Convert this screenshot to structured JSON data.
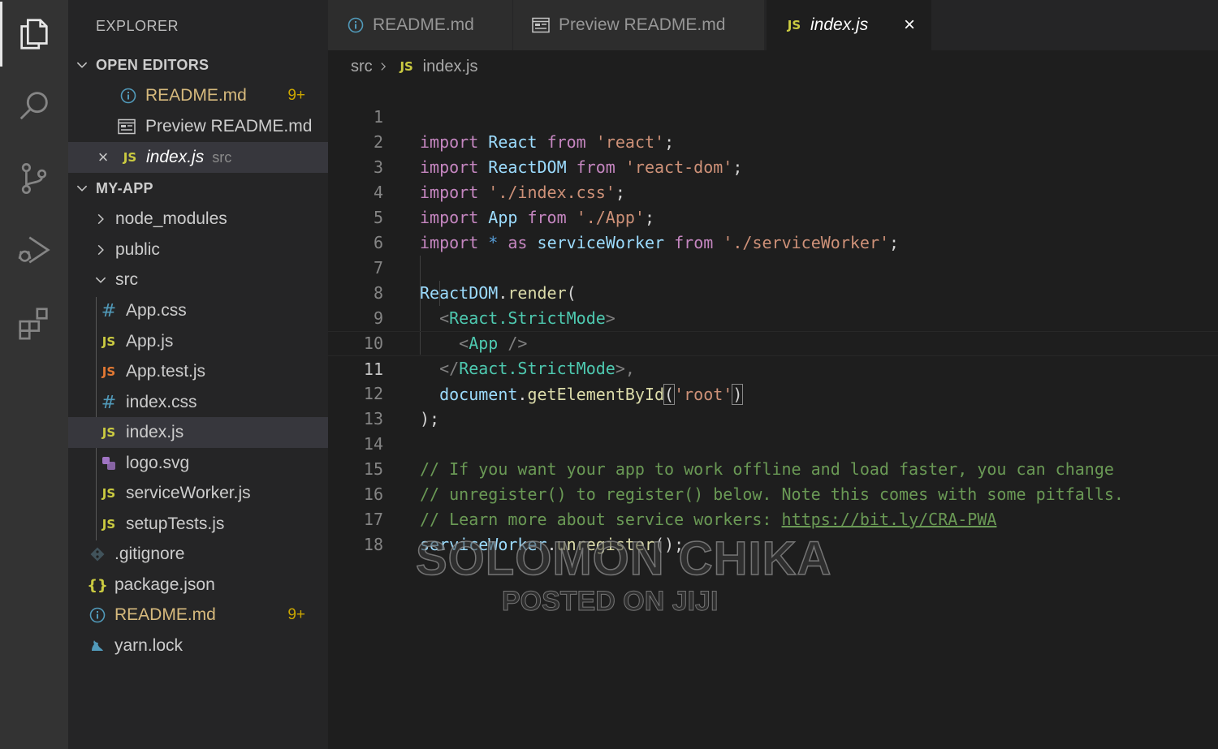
{
  "activity_bar": {
    "items": [
      {
        "icon": "files-icon",
        "active": true
      },
      {
        "icon": "search-icon"
      },
      {
        "icon": "source-control-icon"
      },
      {
        "icon": "run-debug-icon"
      },
      {
        "icon": "extensions-icon"
      }
    ]
  },
  "sidebar": {
    "title": "EXPLORER",
    "open_editors": {
      "header": "OPEN EDITORS",
      "items": [
        {
          "name": "README.md",
          "badge": "9+"
        },
        {
          "name": "Preview README.md"
        },
        {
          "name": "index.js",
          "path": "src"
        }
      ]
    },
    "project": {
      "header": "MY-APP",
      "folders": {
        "node_modules": "node_modules",
        "public": "public",
        "src": "src"
      },
      "src_files": [
        "App.css",
        "App.js",
        "App.test.js",
        "index.css",
        "index.js",
        "logo.svg",
        "serviceWorker.js",
        "setupTests.js"
      ],
      "root_files": [
        ".gitignore",
        "package.json",
        "README.md",
        "yarn.lock"
      ],
      "readme_badge": "9+"
    }
  },
  "tabs": [
    {
      "label": "README.md"
    },
    {
      "label": "Preview README.md"
    },
    {
      "label": "index.js",
      "active": true
    }
  ],
  "breadcrumb": {
    "folder": "src",
    "file": "index.js"
  },
  "editor": {
    "line_numbers": [
      "1",
      "2",
      "3",
      "4",
      "5",
      "6",
      "7",
      "8",
      "9",
      "10",
      "11",
      "12",
      "13",
      "14",
      "15",
      "16",
      "17",
      "18"
    ],
    "tokens": {
      "import": "import",
      "from": "from",
      "as": "as",
      "star": "*",
      "React": "React",
      "ReactDOM": "ReactDOM",
      "App": "App",
      "serviceWorker": "serviceWorker",
      "s_react": "'react'",
      "s_react_dom": "'react-dom'",
      "s_index_css": "'./index.css'",
      "s_app": "'./App'",
      "s_sw": "'./serviceWorker'",
      "semi": ";",
      "render": "render",
      "dot": ".",
      "lparen": "(",
      "rparen": ")",
      "lt": "<",
      "gt": ">",
      "lt_slash": "</",
      "self_close": " />",
      "strict_mode": "React.StrictMode",
      "gt_comma": ">,",
      "document": "document",
      "getElementById": "getElementById",
      "s_root": "'root'",
      "close_call": ");",
      "comment1": "// If you want your app to work offline and load faster, you can change",
      "comment2": "// unregister() to register() below. Note this comes with some pitfalls.",
      "comment3_prefix": "// Learn more about service workers: ",
      "comment3_link": "https://bit.ly/CRA-PWA",
      "unregister": "unregister",
      "call_end": "();"
    }
  },
  "watermark": {
    "line1": "SOLOMON CHIKA",
    "line2": "POSTED ON JIJI"
  },
  "colors": {
    "background": "#1e1e1e",
    "sidebar": "#252526",
    "activity": "#333333",
    "keyword": "#c586c0",
    "string": "#ce9178",
    "variable": "#9cdcfe",
    "comment": "#6a9955"
  }
}
